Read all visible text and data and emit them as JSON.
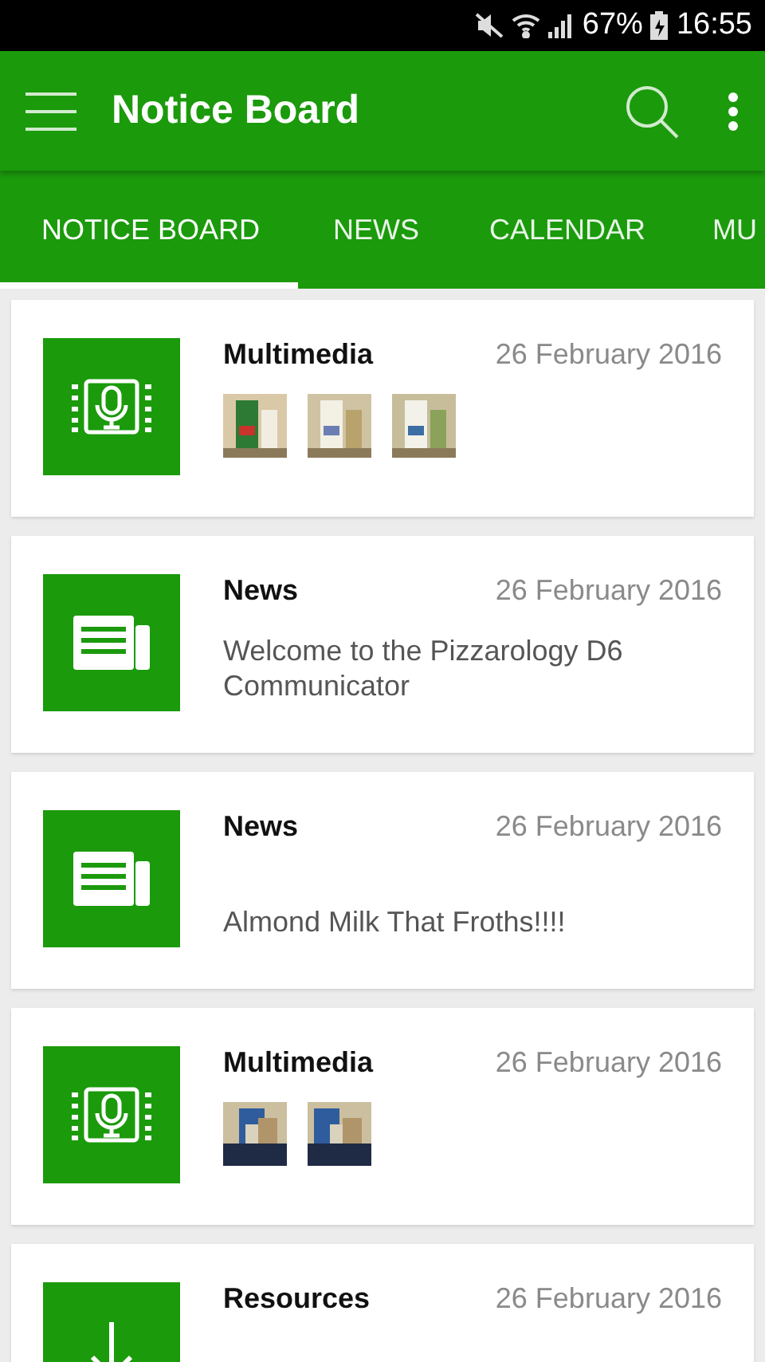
{
  "status_bar": {
    "battery": "67%",
    "time": "16:55"
  },
  "app_bar": {
    "title": "Notice Board"
  },
  "tabs": [
    {
      "label": "NOTICE BOARD",
      "selected": true
    },
    {
      "label": "NEWS",
      "selected": false
    },
    {
      "label": "CALENDAR",
      "selected": false
    },
    {
      "label": "MU",
      "selected": false
    }
  ],
  "items": [
    {
      "kind": "multimedia",
      "title": "Multimedia",
      "date": "26 February 2016"
    },
    {
      "kind": "news",
      "title": "News",
      "date": "26 February 2016",
      "text": "Welcome to the Pizzarology D6 Communicator"
    },
    {
      "kind": "news",
      "title": "News",
      "date": "26 February 2016",
      "text": "Almond Milk That Froths!!!!"
    },
    {
      "kind": "multimedia",
      "title": "Multimedia",
      "date": "26 February 2016"
    },
    {
      "kind": "resources",
      "title": "Resources",
      "date": "26 February 2016"
    }
  ]
}
